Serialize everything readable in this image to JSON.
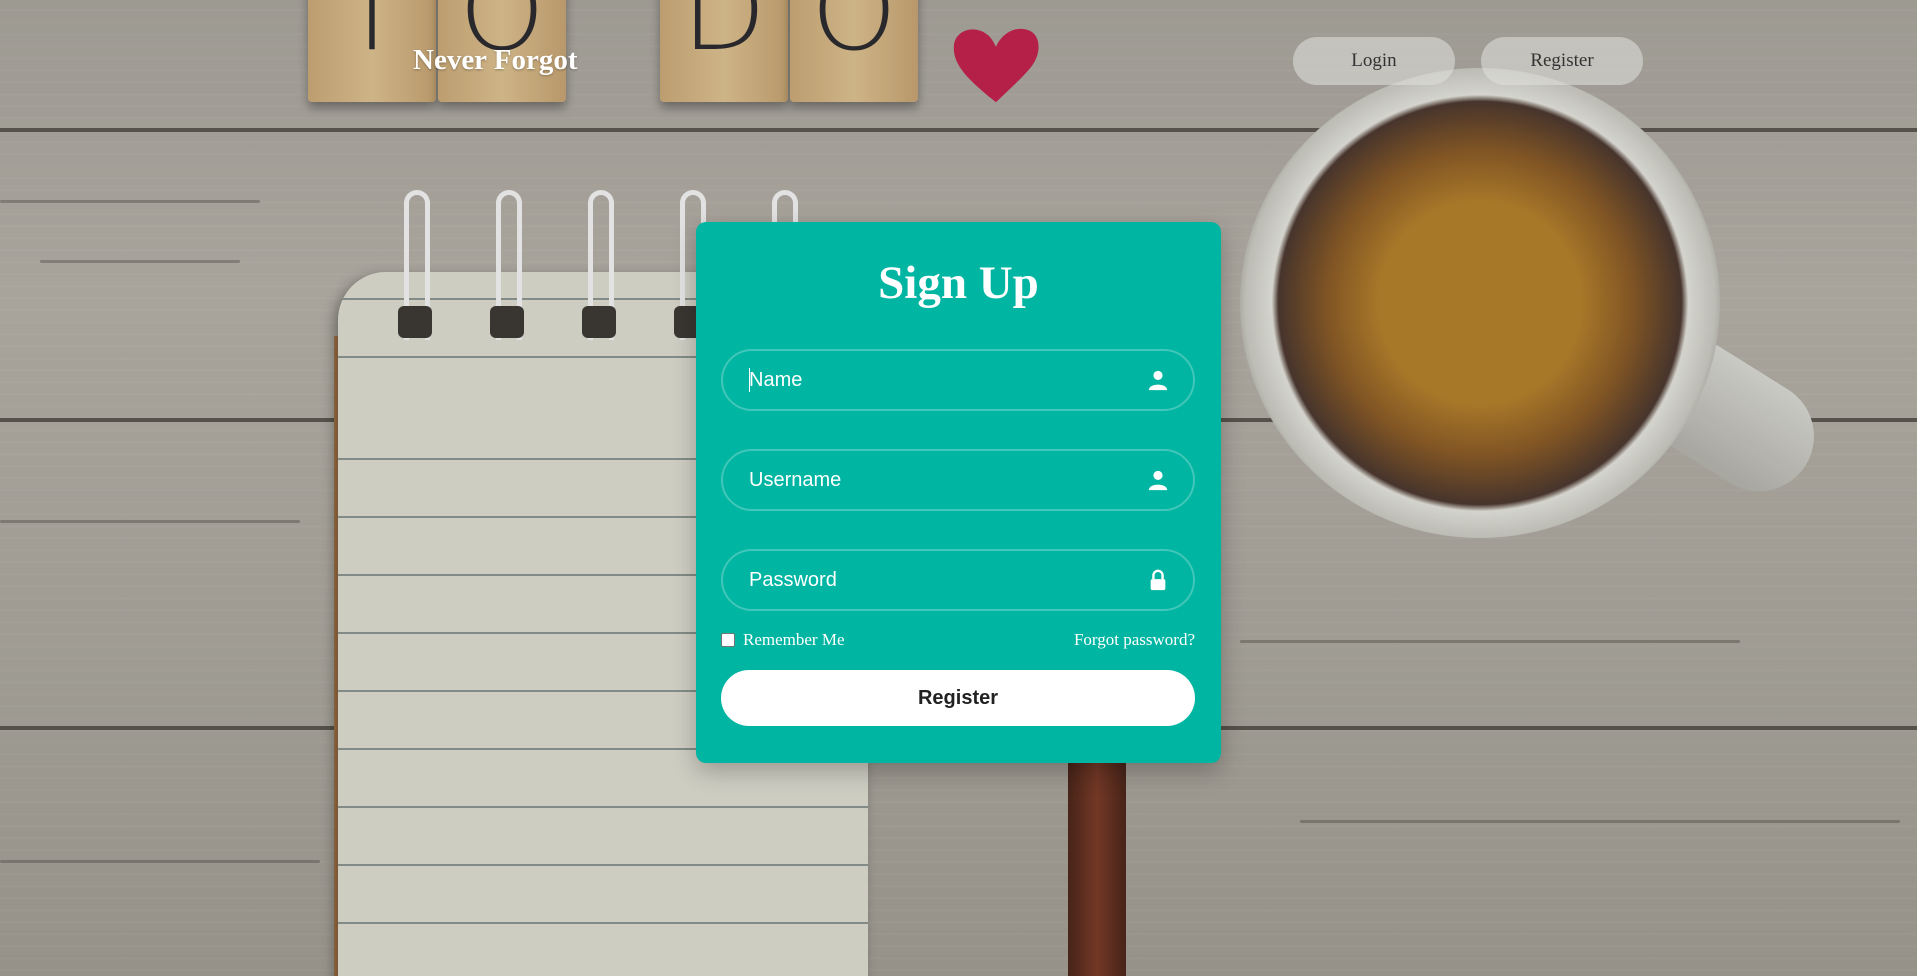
{
  "header": {
    "brand": "Never Forgot",
    "nav": {
      "login_label": "Login",
      "register_label": "Register"
    }
  },
  "background": {
    "tiles": [
      "T",
      "O",
      "D",
      "O"
    ],
    "heart_color": "#c0204a"
  },
  "form": {
    "title": "Sign Up",
    "fields": [
      {
        "placeholder": "Name",
        "icon": "user-icon"
      },
      {
        "placeholder": "Username",
        "icon": "user-icon"
      },
      {
        "placeholder": "Password",
        "icon": "lock-icon"
      }
    ],
    "remember_label": "Remember Me",
    "remember_checked": false,
    "forgot_label": "Forgot password?",
    "submit_label": "Register"
  },
  "colors": {
    "card": "#00b5a2",
    "button_bg": "#ffffff",
    "text_on_card": "#ffffff"
  }
}
